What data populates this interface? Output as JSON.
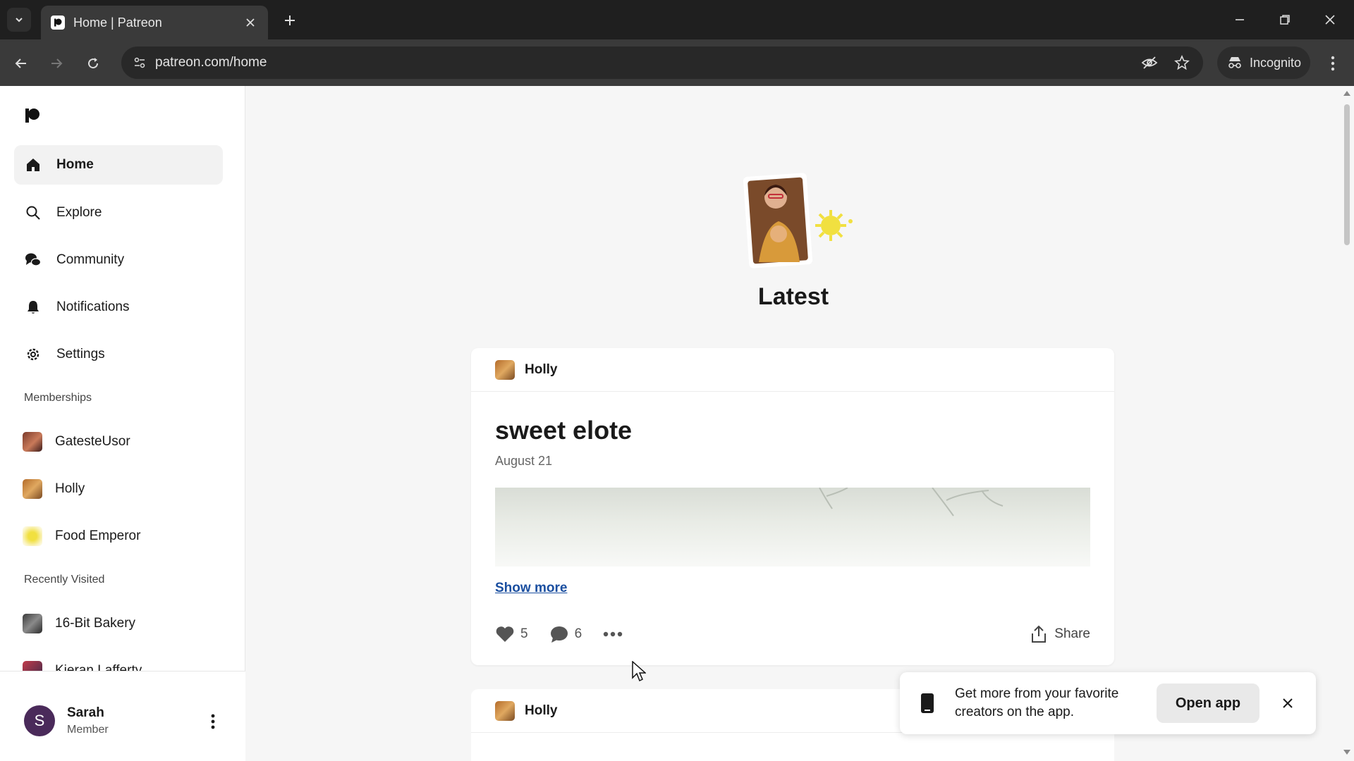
{
  "browser": {
    "tab_title": "Home | Patreon",
    "url": "patreon.com/home",
    "incognito_label": "Incognito"
  },
  "sidebar": {
    "nav": [
      {
        "label": "Home",
        "icon": "home-icon",
        "active": true
      },
      {
        "label": "Explore",
        "icon": "search-icon"
      },
      {
        "label": "Community",
        "icon": "chat-bubbles-icon"
      },
      {
        "label": "Notifications",
        "icon": "bell-icon"
      },
      {
        "label": "Settings",
        "icon": "gear-icon"
      }
    ],
    "memberships_label": "Memberships",
    "memberships": [
      {
        "label": "GatesteUsor"
      },
      {
        "label": "Holly"
      },
      {
        "label": "Food Emperor"
      }
    ],
    "recently_visited_label": "Recently Visited",
    "recently_visited": [
      {
        "label": "16-Bit Bakery"
      },
      {
        "label": "Kieran Lafferty"
      }
    ],
    "user": {
      "initial": "S",
      "name": "Sarah",
      "role": "Member"
    }
  },
  "main": {
    "title": "Latest",
    "posts": [
      {
        "creator": "Holly",
        "title": "sweet elote",
        "date": "August 21",
        "show_more": "Show more",
        "likes": "5",
        "comments": "6",
        "share_label": "Share"
      },
      {
        "creator": "Holly"
      }
    ]
  },
  "app_banner": {
    "text": "Get more from your favorite creators on the app.",
    "button": "Open app"
  },
  "colors": {
    "accent_link": "#1b4fa0",
    "user_avatar": "#4a2a5a"
  }
}
